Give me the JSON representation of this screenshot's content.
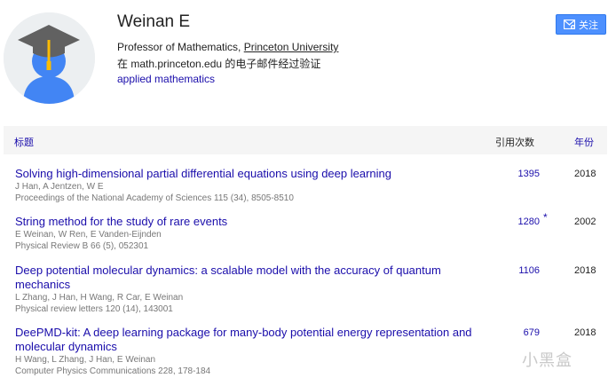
{
  "profile": {
    "name": "Weinan E",
    "affiliation_prefix": "Professor of Mathematics, ",
    "affiliation_link": "Princeton University",
    "verified_email": "在 math.princeton.edu 的电子邮件经过验证",
    "interest": "applied mathematics",
    "avatar_icon": "graduation-cap-avatar-icon"
  },
  "follow_button": {
    "label": "关注",
    "icon": "envelope-icon"
  },
  "table": {
    "headers": {
      "title": "标题",
      "cited_by": "引用次数",
      "year": "年份"
    },
    "rows": [
      {
        "title": "Solving high-dimensional partial differential equations using deep learning",
        "authors": "J Han, A Jentzen, W E",
        "venue": "Proceedings of the National Academy of Sciences 115 (34), 8505-8510",
        "cited_by": "1395",
        "star": "",
        "year": "2018"
      },
      {
        "title": "String method for the study of rare events",
        "authors": "E Weinan, W Ren, E Vanden-Eijnden",
        "venue": "Physical Review B 66 (5), 052301",
        "cited_by": "1280",
        "star": "*",
        "year": "2002"
      },
      {
        "title": "Deep potential molecular dynamics: a scalable model with the accuracy of quantum mechanics",
        "authors": "L Zhang, J Han, H Wang, R Car, E Weinan",
        "venue": "Physical review letters 120 (14), 143001",
        "cited_by": "1106",
        "star": "",
        "year": "2018"
      },
      {
        "title": "DeePMD-kit: A deep learning package for many-body potential energy representation and molecular dynamics",
        "authors": "H Wang, L Zhang, J Han, E Weinan",
        "venue": "Computer Physics Communications 228, 178-184",
        "cited_by": "679",
        "star": "",
        "year": "2018"
      }
    ]
  },
  "watermark": "小黑盒"
}
